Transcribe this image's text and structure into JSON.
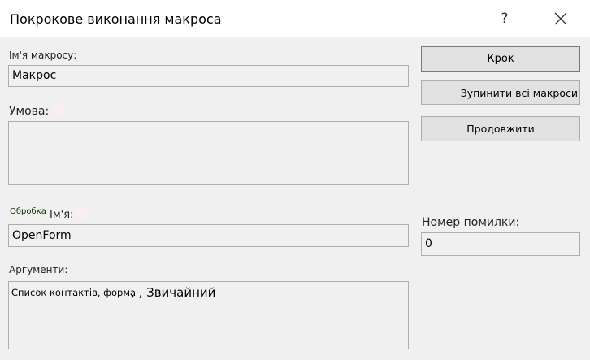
{
  "window": {
    "title": "Покрокове виконання макроса",
    "help_glyph": "?"
  },
  "macro_name": {
    "label": "Ім'я макросу:",
    "value": "Макрос"
  },
  "condition": {
    "label": "Умова:",
    "value": ""
  },
  "action": {
    "prefix": "Обробка",
    "label": "Ім'я:",
    "value": "OpenForm"
  },
  "arguments": {
    "label": "Аргументи:",
    "value_small": "Список контактів, форма",
    "value_large": ", , Звичайний"
  },
  "error_number": {
    "label": "Номер помилки:",
    "value": "0"
  },
  "buttons": {
    "step": "Крок",
    "stop_all": "Зупинити всі макроси",
    "continue": "Продовжити"
  }
}
